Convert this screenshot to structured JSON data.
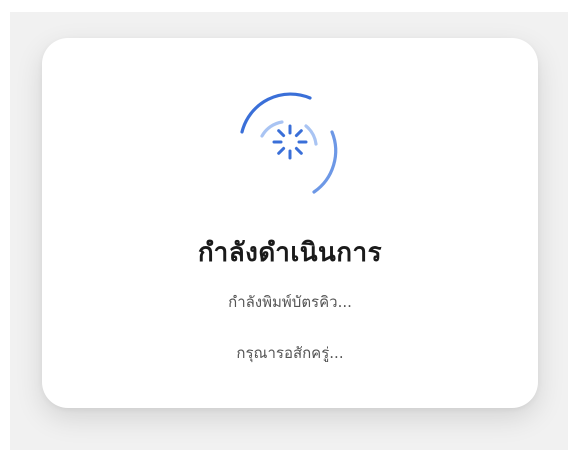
{
  "dialog": {
    "title": "กำลังดำเนินการ",
    "status_message": "กำลังพิมพ์บัตรคิว...",
    "wait_message": "กรุณารอสักครู่..."
  },
  "spinner": {
    "icon": "loading-spinner-icon",
    "accent_color": "#3a6fd8",
    "light_color": "#8fb2ef"
  },
  "colors": {
    "backdrop": "#f1f1f1",
    "card": "#ffffff",
    "title": "#1a1a1a",
    "message": "#555555"
  }
}
